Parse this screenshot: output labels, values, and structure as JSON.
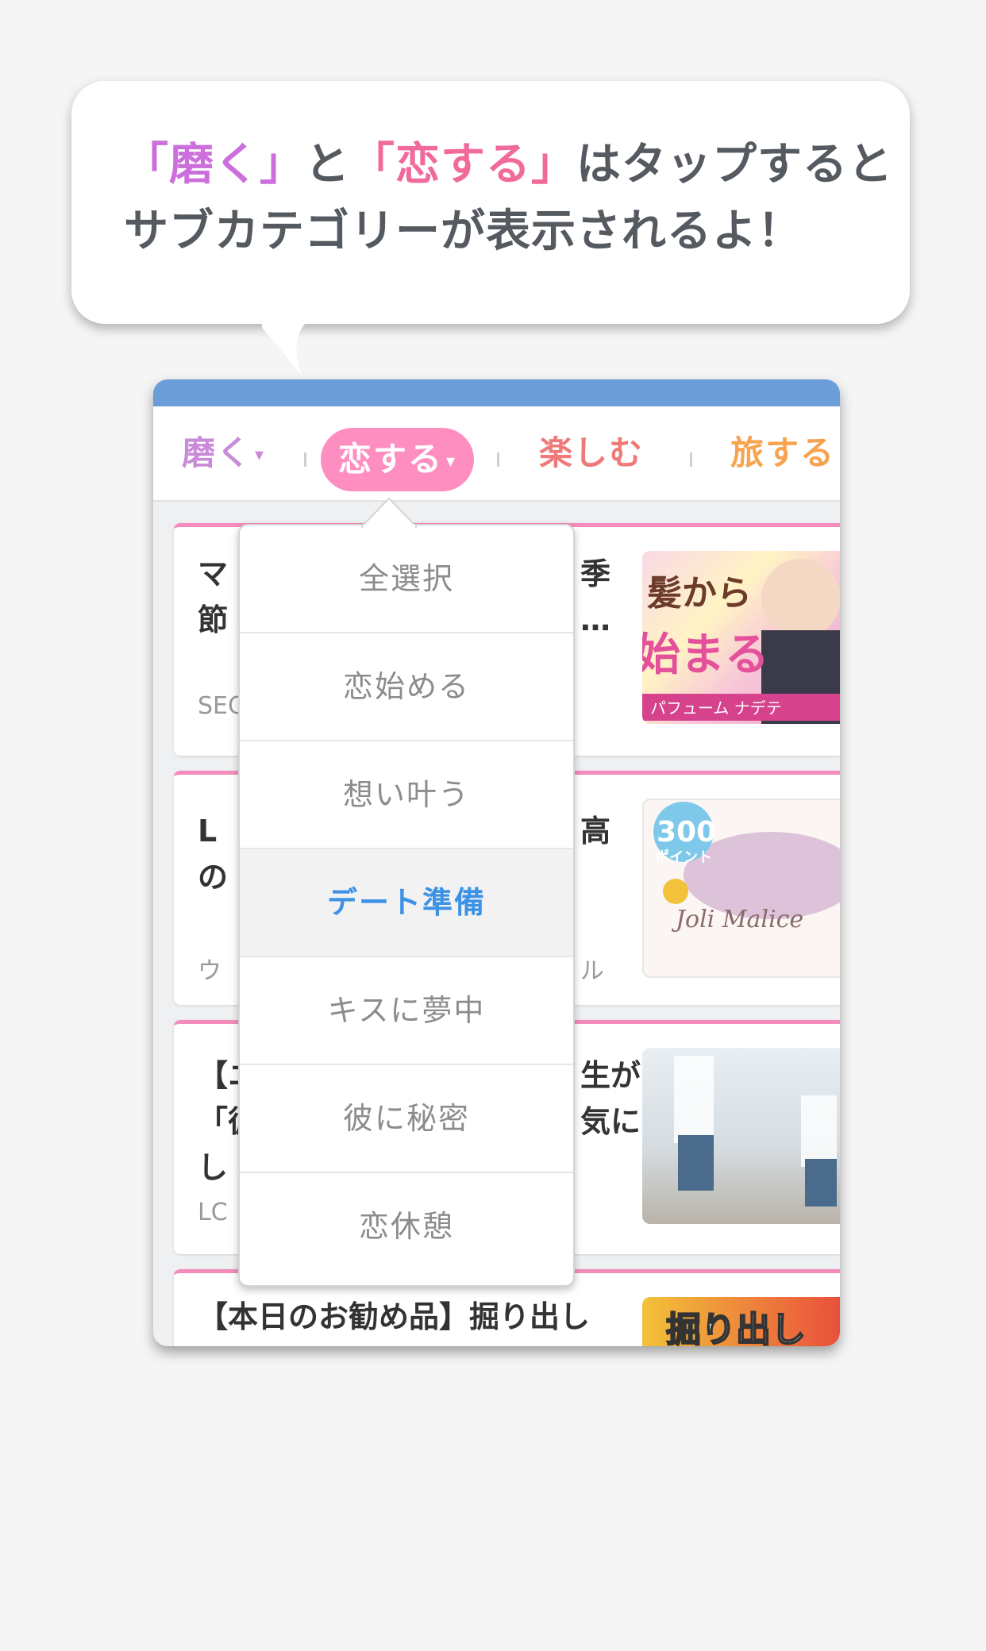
{
  "bubble": {
    "line1_part1": "「磨く」",
    "line1_part2": "と",
    "line1_part3": "「恋する」",
    "line1_part4": "はタップすると",
    "line2": "サブカテゴリーが表示されるよ！"
  },
  "tabs": [
    {
      "label": "磨く",
      "caret": "▾"
    },
    {
      "label": "恋する",
      "caret": "▾"
    },
    {
      "label": "楽しむ"
    },
    {
      "label": "旅する"
    }
  ],
  "dropdown": {
    "items": [
      "全選択",
      "恋始める",
      "想い叶う",
      "デート準備",
      "キスに夢中",
      "彼に秘密",
      "恋休憩"
    ],
    "active_index": 3
  },
  "articles": [
    {
      "line1_left": "マ",
      "line1_right": "季",
      "line2_left": "節",
      "line2_right": "…",
      "source": "SEC"
    },
    {
      "line1_left": "L",
      "line1_right": "高",
      "line2_left": "の",
      "line2_right": "",
      "source": "ウ",
      "source_right": "ル"
    },
    {
      "line1_left": "【ニ",
      "line1_right": "生が",
      "line2_left": "「彼",
      "line2_right": "気に",
      "line3_left": "し",
      "source": "LC"
    },
    {
      "title": "【本日のお勧め品】掘り出し"
    }
  ],
  "thumbs": [
    {
      "text1": "髪から",
      "text2": "始まる",
      "text3": "パフューム ナデテ"
    },
    {
      "text1": "300",
      "text2": "ポイント",
      "text3": "Joli Malice"
    },
    {},
    {
      "text1": "掘り出し"
    }
  ],
  "colors": {
    "accent_pink": "#f58cbb",
    "topbar_blue": "#6b9dd8",
    "active_blue": "#3d92e6"
  }
}
